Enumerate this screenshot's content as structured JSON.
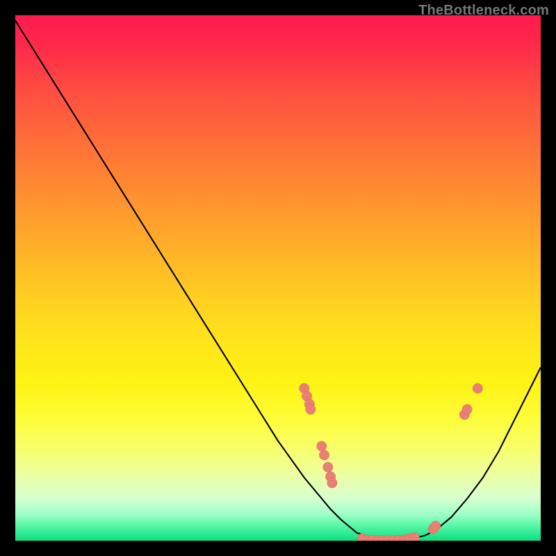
{
  "watermark": {
    "text": "TheBottleneck.com"
  },
  "colors": {
    "curve_stroke": "#000000",
    "marker_fill": "#e98073",
    "marker_stroke": "#d46a5e"
  },
  "chart_data": {
    "type": "line",
    "title": "",
    "xlabel": "",
    "ylabel": "",
    "xlim": [
      0,
      100
    ],
    "ylim": [
      0,
      100
    ],
    "x": [
      0,
      5,
      10,
      15,
      20,
      25,
      30,
      35,
      40,
      45,
      50,
      55,
      60,
      62,
      65,
      68,
      70,
      72,
      74,
      76,
      78,
      80,
      83,
      86,
      89,
      92,
      95,
      98,
      100
    ],
    "values": [
      99,
      91,
      83,
      75,
      67,
      59,
      51,
      43,
      35,
      27,
      19,
      12,
      6,
      4,
      1.5,
      0.5,
      0,
      0,
      0,
      0.5,
      1,
      2,
      4.5,
      8,
      12,
      17,
      23,
      29,
      33
    ],
    "markers": [
      {
        "x": 55,
        "y": 29
      },
      {
        "x": 55.5,
        "y": 27.5
      },
      {
        "x": 56,
        "y": 26
      },
      {
        "x": 56.2,
        "y": 25
      },
      {
        "x": 58.3,
        "y": 18
      },
      {
        "x": 58.8,
        "y": 16.3
      },
      {
        "x": 59.5,
        "y": 14
      },
      {
        "x": 60,
        "y": 12.2
      },
      {
        "x": 60.3,
        "y": 11
      },
      {
        "x": 66,
        "y": 0.4
      },
      {
        "x": 67,
        "y": 0.2
      },
      {
        "x": 68,
        "y": 0.1
      },
      {
        "x": 69,
        "y": 0
      },
      {
        "x": 70,
        "y": 0
      },
      {
        "x": 71,
        "y": 0
      },
      {
        "x": 72,
        "y": 0
      },
      {
        "x": 73,
        "y": 0.1
      },
      {
        "x": 74,
        "y": 0.2
      },
      {
        "x": 75,
        "y": 0.4
      },
      {
        "x": 76,
        "y": 0.6
      },
      {
        "x": 79.5,
        "y": 2.2
      },
      {
        "x": 80,
        "y": 2.8
      },
      {
        "x": 85.5,
        "y": 24
      },
      {
        "x": 86,
        "y": 25
      },
      {
        "x": 88,
        "y": 29
      }
    ],
    "marker_radius": 0.95
  }
}
